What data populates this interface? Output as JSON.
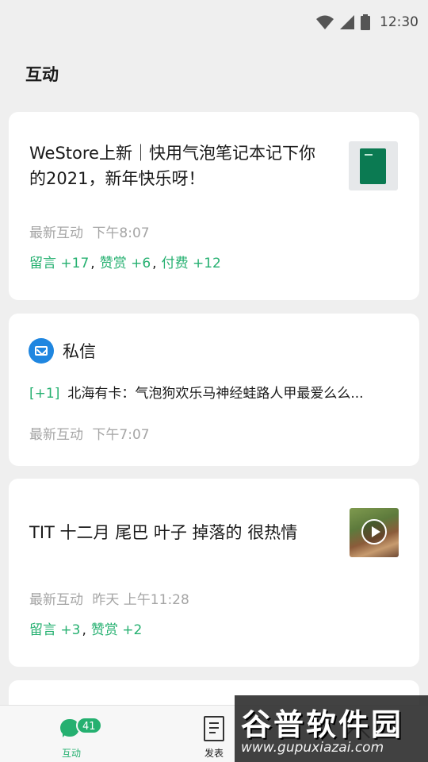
{
  "status_bar": {
    "time": "12:30",
    "icons": [
      "wifi-icon",
      "signal-icon",
      "battery-icon"
    ]
  },
  "page": {
    "title": "互动"
  },
  "cards": [
    {
      "title": "WeStore上新｜快用气泡笔记本记下你的2021，新年快乐呀！",
      "meta_label": "最新互动",
      "meta_time": "下午8:07",
      "thumbnail": "notebook-image",
      "stats": [
        {
          "label": "留言",
          "value": "+17"
        },
        {
          "label": "赞赏",
          "value": "+6"
        },
        {
          "label": "付费",
          "value": "+12"
        }
      ]
    },
    {
      "title": "私信",
      "icon": "mail-icon",
      "message_count": "[+1]",
      "message_text": "北海有卡：气泡狗欢乐马神经蛙路人甲最爱么么...",
      "meta_label": "最新互动",
      "meta_time": "下午7:07"
    },
    {
      "title": "TIT 十二月 尾巴 叶子 掉落的 很热情",
      "meta_label": "最新互动",
      "meta_time": "昨天 上午11:28",
      "thumbnail": "video-thumbnail",
      "stats": [
        {
          "label": "留言",
          "value": "+3"
        },
        {
          "label": "赞赏",
          "value": "+2"
        }
      ]
    }
  ],
  "tab_bar": {
    "tabs": [
      {
        "label": "互动",
        "icon": "chat-bubble-icon",
        "badge": "41",
        "active": true
      },
      {
        "label": "发表",
        "icon": "document-icon",
        "active": false
      },
      {
        "label": "",
        "icon": "arrow-up-icon",
        "active": false
      }
    ]
  },
  "watermark": {
    "title": "谷普软件园",
    "url": "www.gupuxiazai.com"
  },
  "colors": {
    "accent": "#25b070",
    "background": "#efefef",
    "card": "#ffffff",
    "mail_blue": "#1f86e0",
    "meta_gray": "#a5a5a5"
  }
}
